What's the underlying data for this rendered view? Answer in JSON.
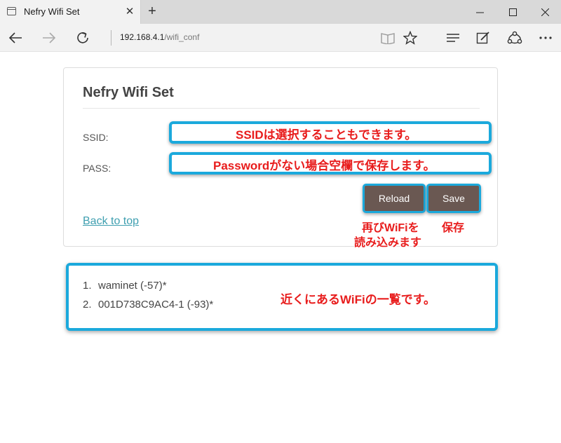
{
  "browser": {
    "tab_title": "Nefry Wifi Set",
    "tab_close": "✕",
    "new_tab": "+",
    "address_host": "192.168.4.1",
    "address_path": "/wifi_conf"
  },
  "page": {
    "title": "Nefry Wifi Set",
    "ssid_label": "SSID:",
    "pass_label": "PASS:",
    "reload_label": "Reload",
    "save_label": "Save",
    "back_link": "Back to top"
  },
  "networks": [
    {
      "num": "1.",
      "text": "waminet (-57)*"
    },
    {
      "num": "2.",
      "text": "001D738C9AC4-1 (-93)*"
    }
  ],
  "annotations": {
    "ssid_note": "SSIDは選択することもできます。",
    "pass_note": "Passwordがない場合空欄で保存します。",
    "reload_note_line1": "再びWiFiを",
    "reload_note_line2": "読み込みます",
    "save_note": "保存",
    "list_note": "近くにあるWiFiの一覧です。"
  },
  "colors": {
    "accent_border": "#1ba9dc",
    "button_bg": "#6a5852",
    "annotation_red": "#e81c1c",
    "link": "#3f9fb0"
  },
  "icons": {
    "back": "back-arrow-icon",
    "forward": "forward-arrow-icon",
    "refresh": "refresh-icon",
    "reading_view": "book-icon",
    "favorite": "star-icon",
    "hub": "hub-icon",
    "web_note": "pen-note-icon",
    "share": "share-icon",
    "more": "more-icon"
  }
}
